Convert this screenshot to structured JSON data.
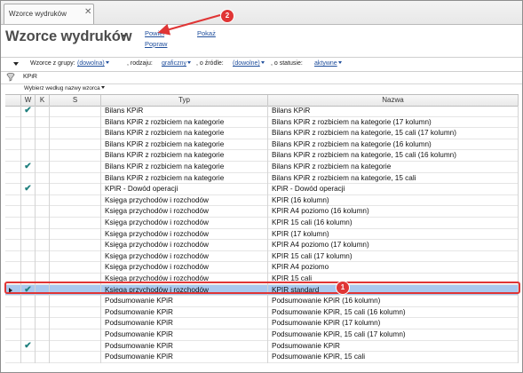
{
  "tab": {
    "label": "Wzorce wydruków",
    "close_glyph": "✕"
  },
  "header": {
    "title": "Wzorce wydruków",
    "links": {
      "powiel": "Powiel",
      "popraw": "Popraw",
      "pokaz": "Pokaż"
    }
  },
  "filters": {
    "group_label": "Wzorce z grupy:",
    "group_value": "(dowolna)",
    "kind_label": ", rodzaju:",
    "kind_value": "graficzny",
    "source_label": ", o źródle:",
    "source_value": "(dowolne)",
    "status_label": ", o statusie:",
    "status_value": "aktywne"
  },
  "search": {
    "value": "KPiR"
  },
  "sort": {
    "label": "Wybierz według nazwy wzorca"
  },
  "table": {
    "columns": [
      "W",
      "K",
      "S",
      "Typ",
      "Nazwa"
    ],
    "rows": [
      {
        "w": true,
        "typ": "Bilans KPiR",
        "nazwa": "Bilans KPiR"
      },
      {
        "w": false,
        "typ": "Bilans KPiR z rozbiciem na kategorie",
        "nazwa": "Bilans KPiR z rozbiciem na kategorie (17 kolumn)"
      },
      {
        "w": false,
        "typ": "Bilans KPiR z rozbiciem na kategorie",
        "nazwa": "Bilans KPiR z rozbiciem na kategorie, 15 cali (17 kolumn)"
      },
      {
        "w": false,
        "typ": "Bilans KPiR z rozbiciem na kategorie",
        "nazwa": "Bilans KPiR z rozbiciem na kategorie (16 kolumn)"
      },
      {
        "w": false,
        "typ": "Bilans KPiR z rozbiciem na kategorie",
        "nazwa": "Bilans KPiR z rozbiciem na kategorie, 15 cali (16 kolumn)"
      },
      {
        "w": true,
        "typ": "Bilans KPiR z rozbiciem na kategorie",
        "nazwa": "Bilans KPiR z rozbiciem na kategorie"
      },
      {
        "w": false,
        "typ": "Bilans KPiR z rozbiciem na kategorie",
        "nazwa": "Bilans KPiR z rozbiciem na kategorie, 15 cali"
      },
      {
        "w": true,
        "typ": "KPiR - Dowód operacji",
        "nazwa": "KPiR - Dowód operacji"
      },
      {
        "w": false,
        "typ": "Księga przychodów i rozchodów",
        "nazwa": "KPIR (16 kolumn)"
      },
      {
        "w": false,
        "typ": "Księga przychodów i rozchodów",
        "nazwa": "KPIR A4 poziomo (16 kolumn)"
      },
      {
        "w": false,
        "typ": "Księga przychodów i rozchodów",
        "nazwa": "KPIR 15 cali (16 kolumn)"
      },
      {
        "w": false,
        "typ": "Księga przychodów i rozchodów",
        "nazwa": "KPIR (17 kolumn)"
      },
      {
        "w": false,
        "typ": "Księga przychodów i rozchodów",
        "nazwa": "KPIR A4 poziomo (17 kolumn)"
      },
      {
        "w": false,
        "typ": "Księga przychodów i rozchodów",
        "nazwa": "KPIR 15 cali (17 kolumn)"
      },
      {
        "w": false,
        "typ": "Księga przychodów i rozchodów",
        "nazwa": "KPIR A4 poziomo"
      },
      {
        "w": false,
        "typ": "Księga przychodów i rozchodów",
        "nazwa": "KPIR 15 cali"
      },
      {
        "w": true,
        "typ": "Księga przychodów i rozchodów",
        "nazwa": "KPIR standard",
        "selected": true
      },
      {
        "w": false,
        "typ": "Podsumowanie KPiR",
        "nazwa": "Podsumowanie KPiR (16 kolumn)"
      },
      {
        "w": false,
        "typ": "Podsumowanie KPiR",
        "nazwa": "Podsumowanie KPiR, 15 cali (16 kolumn)"
      },
      {
        "w": false,
        "typ": "Podsumowanie KPiR",
        "nazwa": "Podsumowanie KPiR (17 kolumn)"
      },
      {
        "w": false,
        "typ": "Podsumowanie KPiR",
        "nazwa": "Podsumowanie KPiR, 15 cali (17 kolumn)"
      },
      {
        "w": true,
        "typ": "Podsumowanie KPiR",
        "nazwa": "Podsumowanie KPiR"
      },
      {
        "w": false,
        "typ": "Podsumowanie KPiR",
        "nazwa": "Podsumowanie KPiR, 15 cali"
      }
    ],
    "check_glyph": "✔"
  },
  "annotations": {
    "badge_selected_row": "1",
    "badge_powiel": "2",
    "highlight_color": "#e03535",
    "selection_color": "#a9c9ef",
    "check_color": "#20807e",
    "link_color": "#1f4e9c"
  }
}
